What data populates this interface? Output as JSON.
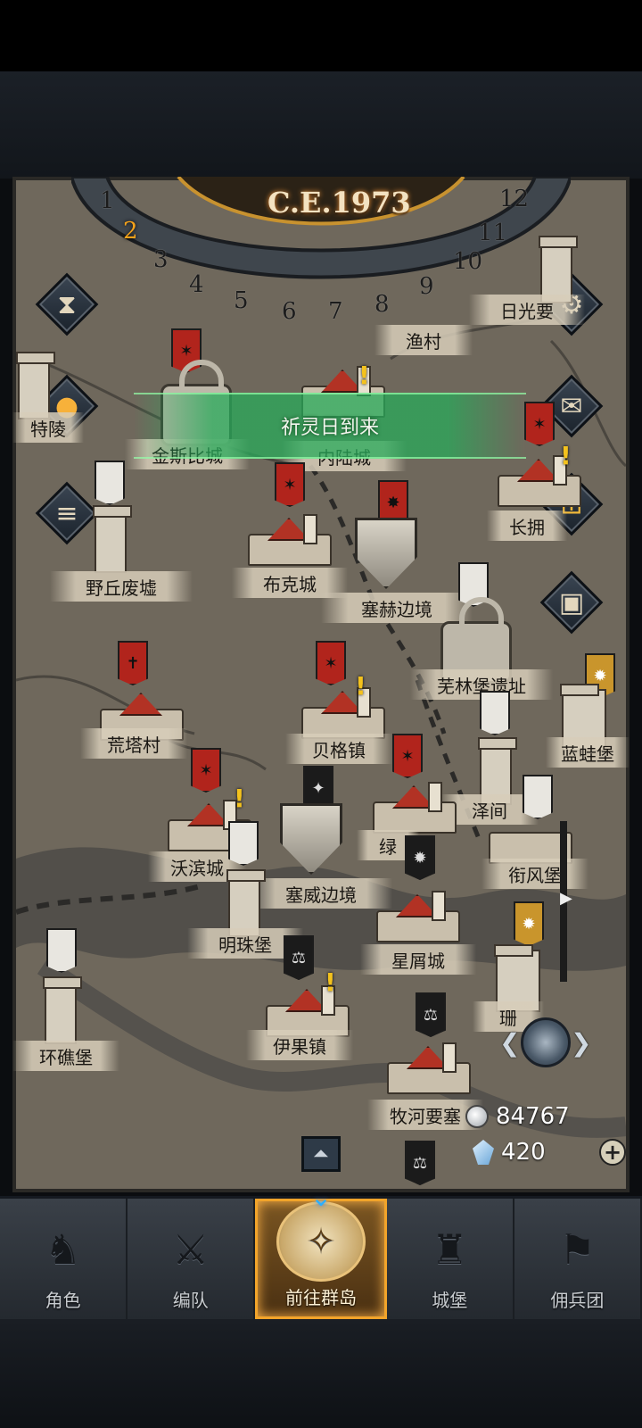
{
  "calendar": {
    "year": "C.E.1973",
    "months": [
      "1",
      "2",
      "3",
      "4",
      "5",
      "6",
      "7",
      "8",
      "9",
      "10",
      "11",
      "12"
    ],
    "active_month": "2"
  },
  "event": {
    "text": "祈灵日到来"
  },
  "places": {
    "jinsi": "金斯比城",
    "inner": "内陆城",
    "rixing": "日光要",
    "yucun": "渔村",
    "te": "特陵",
    "yeqiu": "野丘废墟",
    "buke": "布克城",
    "saihe": "塞赫边境",
    "changyong": "长拥",
    "wulin": "芜林堡遗址",
    "huangta": "荒塔村",
    "beige": "贝格镇",
    "lanwa": "蓝蛙堡",
    "zejian": "泽间",
    "lv": "绿",
    "woban": "沃滨城",
    "saiwei": "塞威边境",
    "xianfeng": "衔风堡",
    "mingzhu": "明珠堡",
    "xingxie": "星屑城",
    "shan": "珊",
    "huanjiao": "环礁堡",
    "yiguo": "伊果镇",
    "muhe": "牧河要塞"
  },
  "currency": {
    "silver": "84767",
    "crystal": "420"
  },
  "nav": [
    {
      "label": "角色",
      "icon": "knight-icon"
    },
    {
      "label": "编队",
      "icon": "formation-icon"
    },
    {
      "label": "前往群岛",
      "icon": "islands-icon"
    },
    {
      "label": "城堡",
      "icon": "castle-icon"
    },
    {
      "label": "佣兵团",
      "icon": "mercenary-icon"
    }
  ],
  "colors": {
    "accent": "#f2a42a",
    "event_green": "#28aa5a",
    "banner_red": "#b1241c"
  }
}
